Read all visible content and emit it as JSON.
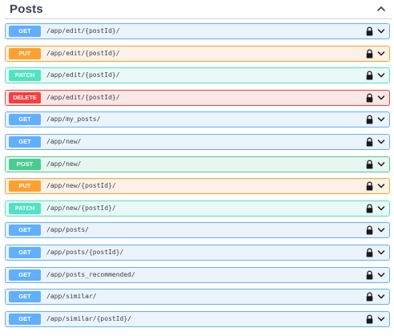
{
  "section": {
    "title": "Posts",
    "collapse_icon": "chevron-up-icon"
  },
  "colors": {
    "GET": {
      "bg": "#ebf3fb",
      "border": "#61affe",
      "badge": "#61affe"
    },
    "PUT": {
      "bg": "#fbf1e6",
      "border": "#fca130",
      "badge": "#fca130"
    },
    "PATCH": {
      "bg": "#e9f9f5",
      "border": "#50e3c2",
      "badge": "#50e3c2"
    },
    "DELETE": {
      "bg": "#fae7e7",
      "border": "#f93e3e",
      "badge": "#f93e3e"
    },
    "POST": {
      "bg": "#e8f6f0",
      "border": "#49cc90",
      "badge": "#49cc90"
    }
  },
  "operations": [
    {
      "method": "GET",
      "path": "/app/edit/{postId}/",
      "lock_icon": "lock-icon",
      "expand_icon": "chevron-down-icon"
    },
    {
      "method": "PUT",
      "path": "/app/edit/{postId}/",
      "lock_icon": "lock-icon",
      "expand_icon": "chevron-down-icon"
    },
    {
      "method": "PATCH",
      "path": "/app/edit/{postId}/",
      "lock_icon": "lock-icon",
      "expand_icon": "chevron-down-icon"
    },
    {
      "method": "DELETE",
      "path": "/app/edit/{postId}/",
      "lock_icon": "lock-icon",
      "expand_icon": "chevron-down-icon"
    },
    {
      "method": "GET",
      "path": "/app/my_posts/",
      "lock_icon": "lock-icon",
      "expand_icon": "chevron-down-icon"
    },
    {
      "method": "GET",
      "path": "/app/new/",
      "lock_icon": "lock-icon",
      "expand_icon": "chevron-down-icon"
    },
    {
      "method": "POST",
      "path": "/app/new/",
      "lock_icon": "lock-icon",
      "expand_icon": "chevron-down-icon"
    },
    {
      "method": "PUT",
      "path": "/app/new/{postId}/",
      "lock_icon": "lock-icon",
      "expand_icon": "chevron-down-icon"
    },
    {
      "method": "PATCH",
      "path": "/app/new/{postId}/",
      "lock_icon": "lock-icon",
      "expand_icon": "chevron-down-icon"
    },
    {
      "method": "GET",
      "path": "/app/posts/",
      "lock_icon": "lock-icon",
      "expand_icon": "chevron-down-icon"
    },
    {
      "method": "GET",
      "path": "/app/posts/{postId}/",
      "lock_icon": "lock-icon",
      "expand_icon": "chevron-down-icon"
    },
    {
      "method": "GET",
      "path": "/app/posts_recommended/",
      "lock_icon": "lock-icon",
      "expand_icon": "chevron-down-icon"
    },
    {
      "method": "GET",
      "path": "/app/similar/",
      "lock_icon": "lock-icon",
      "expand_icon": "chevron-down-icon"
    },
    {
      "method": "GET",
      "path": "/app/similar/{postId}/",
      "lock_icon": "lock-icon",
      "expand_icon": "chevron-down-icon"
    }
  ]
}
